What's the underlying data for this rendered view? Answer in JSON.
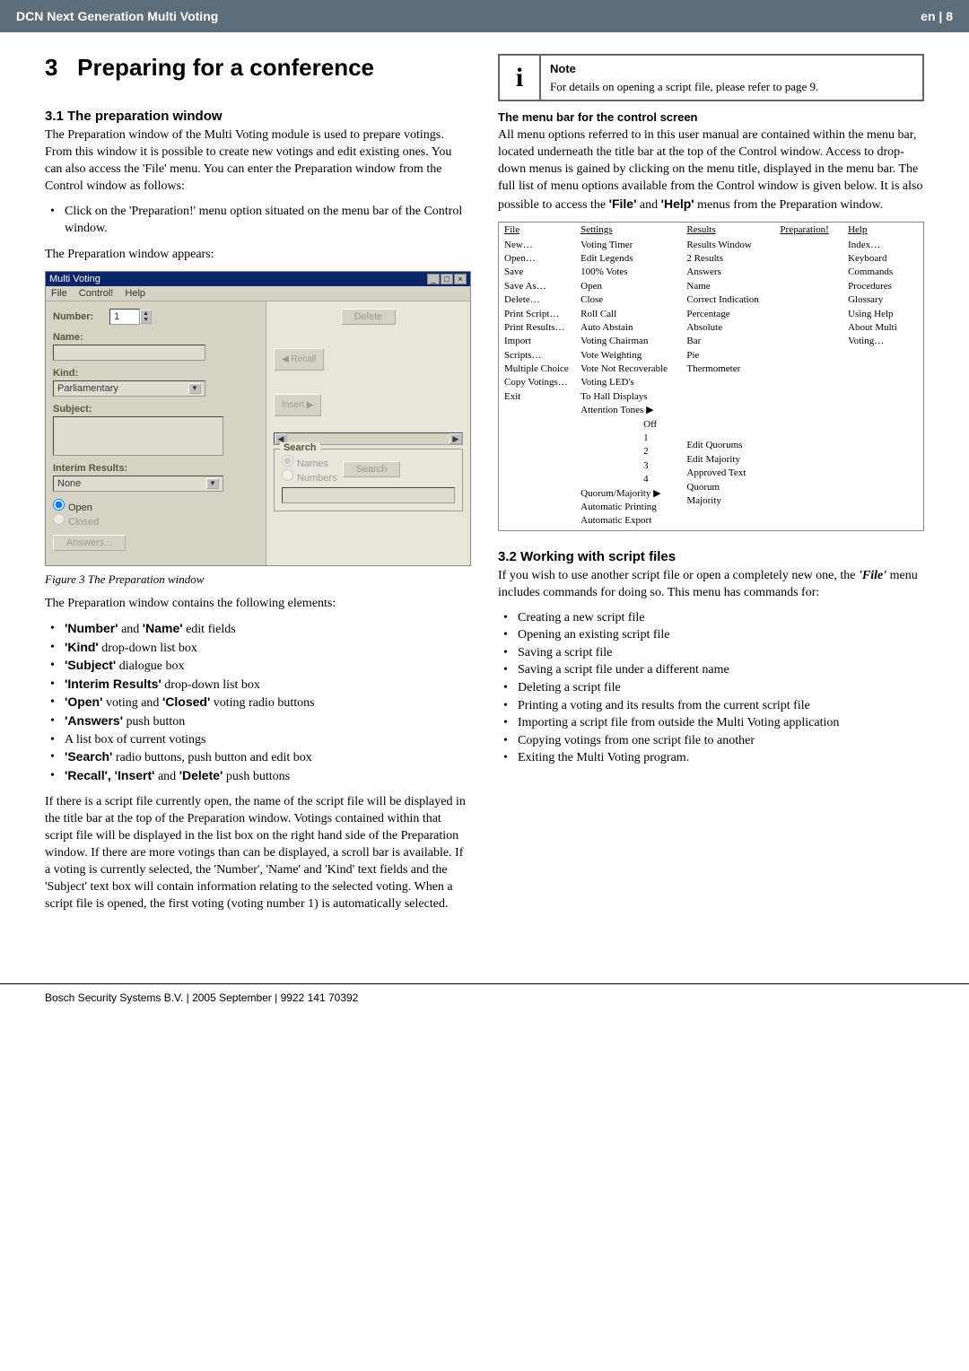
{
  "header": {
    "title_left": "DCN Next Generation Multi Voting",
    "title_right": "en | 8"
  },
  "chapter": {
    "num": "3",
    "title": "Preparing for a conference"
  },
  "s31": {
    "heading": "3.1  The preparation window",
    "para1": "The Preparation window of the Multi Voting module is used to prepare votings. From this window it is possible to create new votings and edit existing ones. You can also access the 'File' menu. You can enter the Preparation window from the Control window as follows:",
    "bullet1": "Click on the 'Preparation!' menu option situated on the menu bar of the Control window.",
    "para2": "The Preparation window appears:"
  },
  "screenshot": {
    "win_title": "Multi Voting",
    "menu_file": "File",
    "menu_control": "Control!",
    "menu_help": "Help",
    "lbl_number": "Number:",
    "val_number": "1",
    "lbl_name": "Name:",
    "lbl_kind": "Kind:",
    "val_kind": "Parliamentary",
    "lbl_subject": "Subject:",
    "lbl_interim": "Interim Results:",
    "val_interim": "None",
    "rad_open": "Open",
    "rad_closed": "Closed",
    "btn_answers": "Answers...",
    "btn_delete": "Delete",
    "btn_recall": "Recall",
    "btn_insert": "Insert",
    "grp_search": "Search",
    "rad_names": "Names",
    "rad_numbers": "Numbers",
    "btn_search": "Search"
  },
  "fig_caption": "Figure 3 The Preparation window",
  "elements_intro": "The Preparation window contains the following elements:",
  "elements": [
    {
      "pre": "",
      "b1": "'Number'",
      "mid": " and ",
      "b2": "'Name'",
      "post": " edit fields"
    },
    {
      "pre": "",
      "b1": "'Kind'",
      "post": " drop-down list box"
    },
    {
      "pre": "",
      "b1": "'Subject'",
      "post": " dialogue box"
    },
    {
      "pre": "",
      "b1": "'Interim Results'",
      "post": " drop-down list box"
    },
    {
      "pre": "",
      "b1": "'Open'",
      "mid": " voting and ",
      "b2": "'Closed'",
      "post": " voting radio buttons"
    },
    {
      "pre": "",
      "b1": "'Answers'",
      "post": " push button"
    },
    {
      "plain": "A list box of current votings"
    },
    {
      "pre": "",
      "b1": "'Search'",
      "post": " radio buttons, push button and edit box"
    },
    {
      "pre": "",
      "b1": "'Recall', 'Insert'",
      "mid": " and ",
      "b2": "'Delete'",
      "post": " push buttons"
    }
  ],
  "s31_tail": "If there is a script file currently open, the name of the script file will be displayed in the title bar at the top of the Preparation window. Votings contained within that script file will be displayed in the list box on the right hand side of the Preparation window. If there are more votings than can be displayed, a scroll bar is available. If a voting is currently selected, the 'Number', 'Name' and 'Kind' text fields and the 'Subject' text box will contain information relating to the selected voting. When a script file is opened, the first voting (voting number 1) is automatically selected.",
  "note": {
    "title": "Note",
    "body": "For details on opening a script file, please refer to page 9."
  },
  "menubar": {
    "heading": "The menu bar for the control screen",
    "para": "All menu options referred to in this user manual are contained within the menu bar, located underneath the title bar at the top of the Control window. Access to drop-down menus is gained by clicking on the menu title, displayed in the menu bar. The full list of menu options available from the Control window is given below. It is also possible to access the ",
    "b1": "'File'",
    "mid": " and ",
    "b2": "'Help'",
    "post": " menus from the Preparation window."
  },
  "menu_table": {
    "heads": [
      "File",
      "Settings",
      "Results",
      "Preparation!",
      "Help"
    ],
    "col1": [
      "New…",
      "Open…",
      "Save",
      "Save As…",
      "Delete…",
      "Print Script…",
      "Print Results…",
      "Import Scripts…",
      "Multiple Choice",
      "Copy Votings…",
      "Exit"
    ],
    "col2": [
      "Voting Timer",
      "Edit Legends",
      "100% Votes",
      "Open",
      "Close",
      "Roll Call",
      "Auto Abstain",
      "Voting Chairman",
      "Vote Weighting",
      "Vote Not Recoverable",
      "Voting LED's",
      "To Hall Displays",
      "Attention Tones ▶",
      "",
      "",
      "",
      "",
      "Quorum/Majority ▶",
      "Automatic Printing",
      "Automatic Export"
    ],
    "col2_sub_tones": [
      "Off",
      "1",
      "2",
      "3",
      "4"
    ],
    "col2_sub_qm": [
      "Edit Quorums",
      "Edit Majority",
      "Approved Text",
      "Quorum",
      "Majority"
    ],
    "col3": [
      "Results Window",
      "2 Results",
      "Answers",
      "Name",
      "Correct Indication",
      "Percentage",
      "Absolute",
      "Bar",
      "Pie",
      "Thermometer"
    ],
    "col5": [
      "Index…",
      "Keyboard",
      "Commands",
      "Procedures",
      "Glossary",
      "Using Help",
      "About Multi Voting…"
    ]
  },
  "s32": {
    "heading": "3.2  Working with script files",
    "para": "If you wish to use another script file or open a completely new one, the ",
    "b1": "'File'",
    "post": " menu includes commands for doing so. This menu has commands for:",
    "items": [
      "Creating a new script file",
      "Opening an existing script file",
      "Saving a script file",
      "Saving a script file under a different name",
      "Deleting a script file",
      "Printing a voting and its results from the current script file",
      "Importing a script file from outside the Multi Voting application",
      "Copying votings from one script file to another",
      "Exiting the Multi Voting program."
    ]
  },
  "footer": "Bosch Security Systems B.V. | 2005 September | 9922 141 70392"
}
